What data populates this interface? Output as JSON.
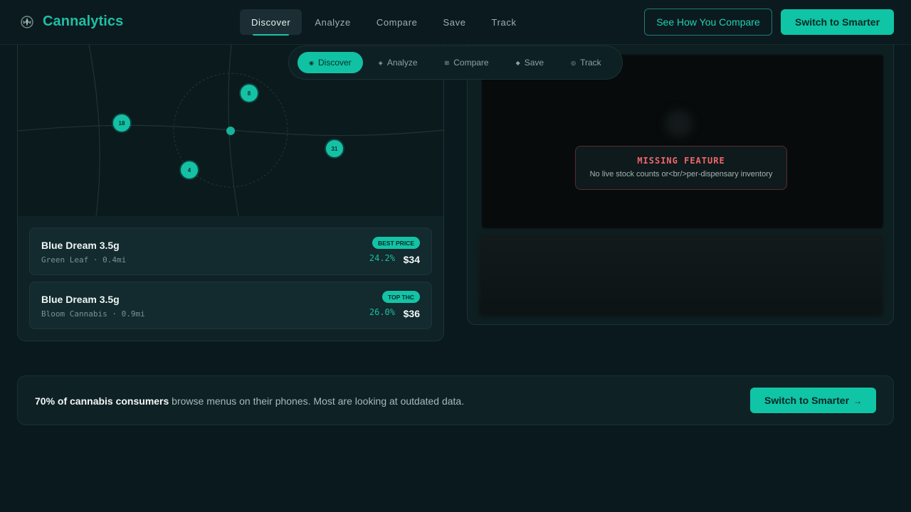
{
  "header": {
    "brand": "Cannalytics",
    "nav": [
      "Discover",
      "Analyze",
      "Compare",
      "Save",
      "Track"
    ],
    "active_nav": "Discover",
    "compare_button": "See How You Compare",
    "cta_button": "Switch to Smarter"
  },
  "map": {
    "pins": [
      "8",
      "18",
      "31",
      "4"
    ]
  },
  "listings": [
    {
      "title": "Blue Dream 3.5g",
      "subtitle": "Green Leaf · 0.4mi",
      "badge": "BEST PRICE",
      "thc": "24.2%",
      "price": "$34"
    },
    {
      "title": "Blue Dream 3.5g",
      "subtitle": "Bloom Cannabis · 0.9mi",
      "badge": "TOP THC",
      "thc": "26.0%",
      "price": "$36"
    }
  ],
  "pill_nav": {
    "items": [
      {
        "icon": "◉",
        "label": "Discover"
      },
      {
        "icon": "◈",
        "label": "Analyze"
      },
      {
        "icon": "⊞",
        "label": "Compare"
      },
      {
        "icon": "◆",
        "label": "Save"
      },
      {
        "icon": "◎",
        "label": "Track"
      }
    ],
    "active": "Discover"
  },
  "missing_feature": {
    "title": "MISSING FEATURE",
    "description": "No live stock counts or<br/>per-dispensary inventory"
  },
  "banner": {
    "bold": "70% of cannabis consumers",
    "text": " browse menus on their phones. Most are looking at outdated data.",
    "button": "Switch to Smarter",
    "button_arrow": "→"
  },
  "colors": {
    "accent": "#10c4a6",
    "background": "#0a191d",
    "warning": "#f06868"
  }
}
